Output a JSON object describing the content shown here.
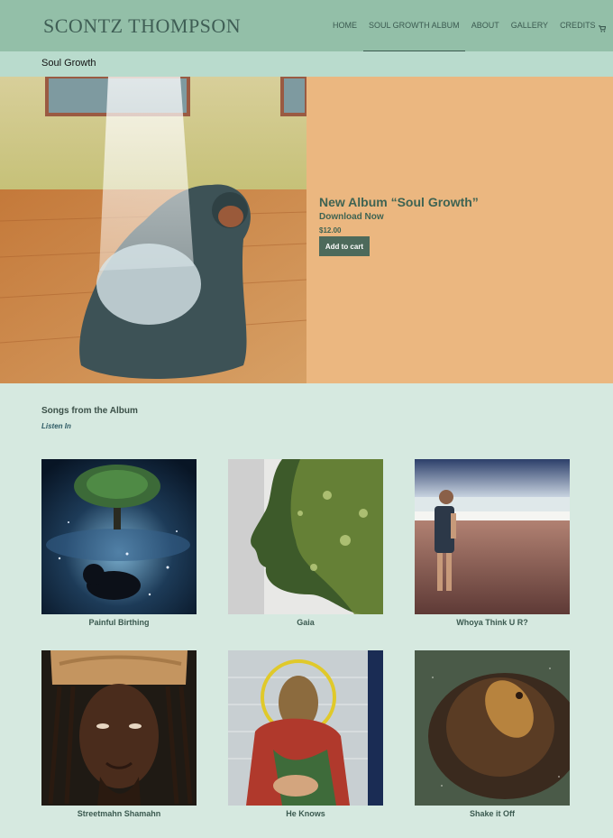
{
  "site": {
    "logo": "SCONTZ THOMPSON"
  },
  "nav": {
    "items": [
      {
        "label": "HOME"
      },
      {
        "label": "SOUL GROWTH ALBUM"
      },
      {
        "label": "ABOUT"
      },
      {
        "label": "GALLERY"
      },
      {
        "label": "CREDITS"
      }
    ],
    "active_index": 1,
    "cart_icon": "shopping-cart-icon"
  },
  "page": {
    "title": "Soul Growth"
  },
  "hero": {
    "album_title": "New Album “Soul Growth”",
    "download_label": "Download Now",
    "price": "$12.00",
    "button_label": "Add to cart"
  },
  "songs": {
    "heading": "Songs from the Album",
    "listen_label": "Listen In",
    "items": [
      {
        "title": "Painful Birthing"
      },
      {
        "title": "Gaia"
      },
      {
        "title": "Whoya Think U R?"
      },
      {
        "title": "Streetmahn Shamahn"
      },
      {
        "title": "He Knows"
      },
      {
        "title": "Shake it Off"
      }
    ]
  },
  "colors": {
    "header_bg": "#93bfa8",
    "title_bar_bg": "#b9dbcd",
    "page_bg": "#d6e9e0",
    "hero_panel_bg": "#ebb780",
    "button_bg": "#4d6a5b",
    "text_green": "#3e6352"
  }
}
